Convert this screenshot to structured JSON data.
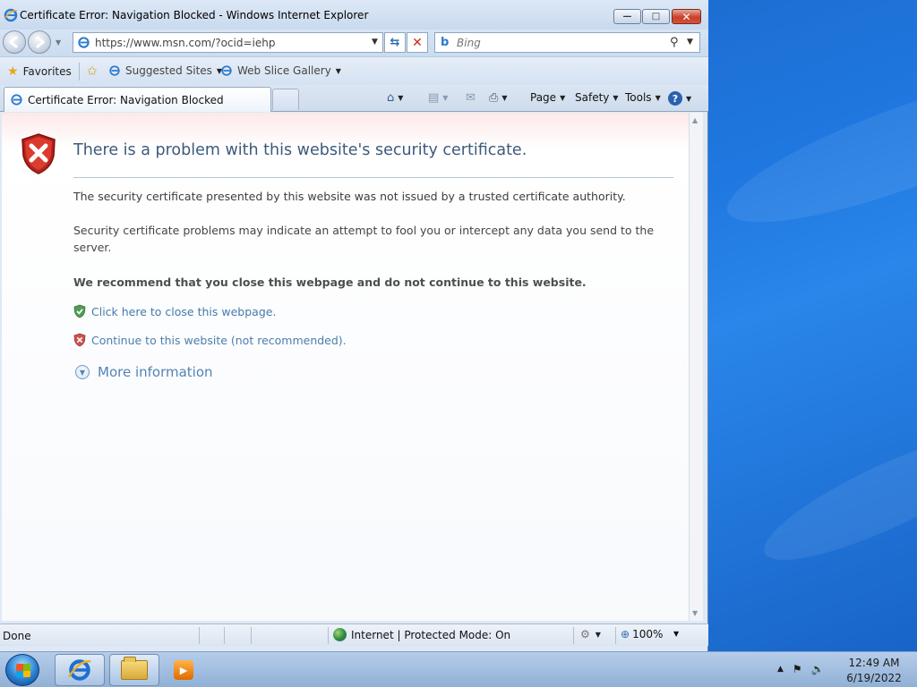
{
  "window": {
    "title": "Certificate Error: Navigation Blocked - Windows Internet Explorer",
    "minimize_glyph": "—",
    "maximize_glyph": "□",
    "close_glyph": "✕"
  },
  "address_bar": {
    "url": "https://www.msn.com/?ocid=iehp",
    "refresh_glyph": "⇆",
    "stop_glyph": "✕"
  },
  "search": {
    "placeholder": "Bing",
    "logo": "b"
  },
  "favorites_bar": {
    "favorites_label": "Favorites",
    "suggested_sites_label": "Suggested Sites",
    "web_slice_label": "Web Slice Gallery"
  },
  "tabs": [
    {
      "label": "Certificate Error: Navigation Blocked",
      "active": true
    }
  ],
  "command_bar": {
    "page_label": "Page",
    "safety_label": "Safety",
    "tools_label": "Tools",
    "help_glyph": "?"
  },
  "content": {
    "title": "There is a problem with this website's security certificate.",
    "para1": "The security certificate presented by this website was not issued by a trusted certificate authority.",
    "para2": "Security certificate problems may indicate an attempt to fool you or intercept any data you send to the server.",
    "recommend": "We recommend that you close this webpage and do not continue to this website.",
    "close_link": "Click here to close this webpage.",
    "continue_link": "Continue to this website (not recommended).",
    "more_info": "More information"
  },
  "status_bar": {
    "status": "Done",
    "zone": "Internet | Protected Mode: On",
    "zoom": "100%"
  },
  "taskbar": {
    "time": "12:49 AM",
    "date": "6/19/2022"
  },
  "colors": {
    "link": "#1f5f99",
    "title": "#3c5a7a",
    "error_red": "#c8281e",
    "safe_green": "#2e8b2e"
  },
  "icons": {
    "title_icon": "ie-icon",
    "error_shield": "error-shield-icon",
    "close_shield": "green-shield-icon",
    "continue_shield": "red-shield-icon",
    "more_info": "chevron-down-circle-icon"
  }
}
